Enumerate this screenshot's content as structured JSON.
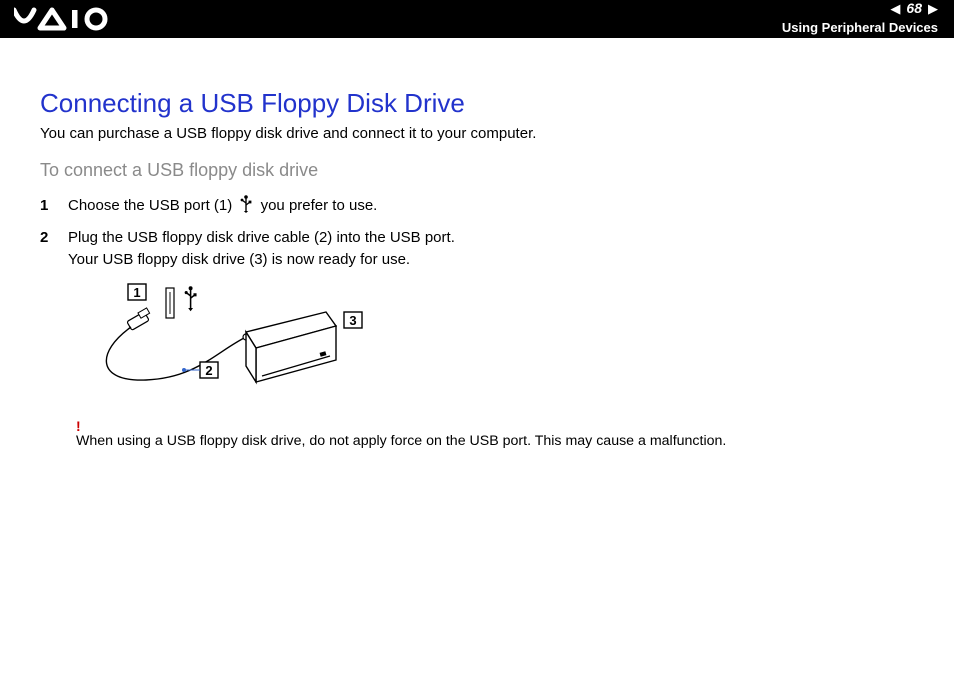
{
  "header": {
    "page_number": "68",
    "section_title": "Using Peripheral Devices"
  },
  "main": {
    "title": "Connecting a USB Floppy Disk Drive",
    "intro": "You can purchase a USB floppy disk drive and connect it to your computer.",
    "subheading": "To connect a USB floppy disk drive",
    "steps": [
      {
        "num": "1",
        "text_before_icon": "Choose the USB port (1) ",
        "text_after_icon": " you prefer to use."
      },
      {
        "num": "2",
        "line1": "Plug the USB floppy disk drive cable (2) into the USB port.",
        "line2": "Your USB floppy disk drive (3) is now ready for use."
      }
    ],
    "diagram_callouts": {
      "c1": "1",
      "c2": "2",
      "c3": "3"
    },
    "warning_mark": "!",
    "warning_text": "When using a USB floppy disk drive, do not apply force on the USB port. This may cause a malfunction."
  }
}
